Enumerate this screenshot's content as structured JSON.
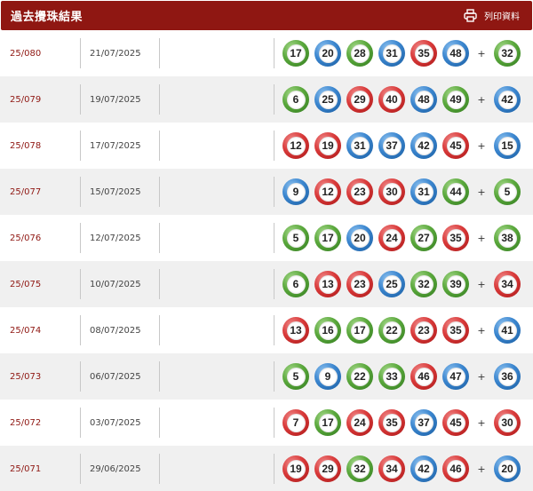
{
  "header": {
    "title": "過去攪珠結果",
    "print_label": "列印資料"
  },
  "colors": {
    "header_bg": "#8f1712",
    "red": "#d93a3a",
    "blue": "#3b86cf",
    "green": "#5aa83c"
  },
  "results": [
    {
      "draw": "25/080",
      "date": "21/07/2025",
      "balls": [
        {
          "n": "17",
          "c": "green"
        },
        {
          "n": "20",
          "c": "blue"
        },
        {
          "n": "28",
          "c": "green"
        },
        {
          "n": "31",
          "c": "blue"
        },
        {
          "n": "35",
          "c": "red"
        },
        {
          "n": "48",
          "c": "blue"
        }
      ],
      "extra": {
        "n": "32",
        "c": "green"
      }
    },
    {
      "draw": "25/079",
      "date": "19/07/2025",
      "balls": [
        {
          "n": "6",
          "c": "green"
        },
        {
          "n": "25",
          "c": "blue"
        },
        {
          "n": "29",
          "c": "red"
        },
        {
          "n": "40",
          "c": "red"
        },
        {
          "n": "48",
          "c": "blue"
        },
        {
          "n": "49",
          "c": "green"
        }
      ],
      "extra": {
        "n": "42",
        "c": "blue"
      }
    },
    {
      "draw": "25/078",
      "date": "17/07/2025",
      "balls": [
        {
          "n": "12",
          "c": "red"
        },
        {
          "n": "19",
          "c": "red"
        },
        {
          "n": "31",
          "c": "blue"
        },
        {
          "n": "37",
          "c": "blue"
        },
        {
          "n": "42",
          "c": "blue"
        },
        {
          "n": "45",
          "c": "red"
        }
      ],
      "extra": {
        "n": "15",
        "c": "blue"
      }
    },
    {
      "draw": "25/077",
      "date": "15/07/2025",
      "balls": [
        {
          "n": "9",
          "c": "blue"
        },
        {
          "n": "12",
          "c": "red"
        },
        {
          "n": "23",
          "c": "red"
        },
        {
          "n": "30",
          "c": "red"
        },
        {
          "n": "31",
          "c": "blue"
        },
        {
          "n": "44",
          "c": "green"
        }
      ],
      "extra": {
        "n": "5",
        "c": "green"
      }
    },
    {
      "draw": "25/076",
      "date": "12/07/2025",
      "balls": [
        {
          "n": "5",
          "c": "green"
        },
        {
          "n": "17",
          "c": "green"
        },
        {
          "n": "20",
          "c": "blue"
        },
        {
          "n": "24",
          "c": "red"
        },
        {
          "n": "27",
          "c": "green"
        },
        {
          "n": "35",
          "c": "red"
        }
      ],
      "extra": {
        "n": "38",
        "c": "green"
      }
    },
    {
      "draw": "25/075",
      "date": "10/07/2025",
      "balls": [
        {
          "n": "6",
          "c": "green"
        },
        {
          "n": "13",
          "c": "red"
        },
        {
          "n": "23",
          "c": "red"
        },
        {
          "n": "25",
          "c": "blue"
        },
        {
          "n": "32",
          "c": "green"
        },
        {
          "n": "39",
          "c": "green"
        }
      ],
      "extra": {
        "n": "34",
        "c": "red"
      }
    },
    {
      "draw": "25/074",
      "date": "08/07/2025",
      "balls": [
        {
          "n": "13",
          "c": "red"
        },
        {
          "n": "16",
          "c": "green"
        },
        {
          "n": "17",
          "c": "green"
        },
        {
          "n": "22",
          "c": "green"
        },
        {
          "n": "23",
          "c": "red"
        },
        {
          "n": "35",
          "c": "red"
        }
      ],
      "extra": {
        "n": "41",
        "c": "blue"
      }
    },
    {
      "draw": "25/073",
      "date": "06/07/2025",
      "balls": [
        {
          "n": "5",
          "c": "green"
        },
        {
          "n": "9",
          "c": "blue"
        },
        {
          "n": "22",
          "c": "green"
        },
        {
          "n": "33",
          "c": "green"
        },
        {
          "n": "46",
          "c": "red"
        },
        {
          "n": "47",
          "c": "blue"
        }
      ],
      "extra": {
        "n": "36",
        "c": "blue"
      }
    },
    {
      "draw": "25/072",
      "date": "03/07/2025",
      "balls": [
        {
          "n": "7",
          "c": "red"
        },
        {
          "n": "17",
          "c": "green"
        },
        {
          "n": "24",
          "c": "red"
        },
        {
          "n": "35",
          "c": "red"
        },
        {
          "n": "37",
          "c": "blue"
        },
        {
          "n": "45",
          "c": "red"
        }
      ],
      "extra": {
        "n": "30",
        "c": "red"
      }
    },
    {
      "draw": "25/071",
      "date": "29/06/2025",
      "balls": [
        {
          "n": "19",
          "c": "red"
        },
        {
          "n": "29",
          "c": "red"
        },
        {
          "n": "32",
          "c": "green"
        },
        {
          "n": "34",
          "c": "red"
        },
        {
          "n": "42",
          "c": "blue"
        },
        {
          "n": "46",
          "c": "red"
        }
      ],
      "extra": {
        "n": "20",
        "c": "blue"
      }
    }
  ]
}
